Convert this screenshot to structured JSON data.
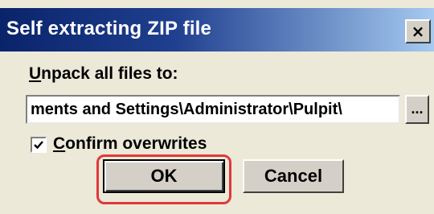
{
  "window": {
    "title": "Self extracting ZIP file",
    "close_glyph": "×"
  },
  "unpack": {
    "label_accel": "U",
    "label_rest": "npack all files to:",
    "path_value": "ments and Settings\\Administrator\\Pulpit\\",
    "browse_label": "..."
  },
  "confirm": {
    "checked": true,
    "label_accel": "C",
    "label_rest": "onfirm overwrites"
  },
  "buttons": {
    "ok_label": "OK",
    "cancel_label": "Cancel"
  },
  "colors": {
    "titlebar_start": "#0a246a",
    "titlebar_end": "#a6caf0",
    "dialog_bg": "#ece9d8",
    "highlight": "#e0383b"
  },
  "icons": {
    "close": "close-icon",
    "checkmark": "checkmark-icon"
  }
}
